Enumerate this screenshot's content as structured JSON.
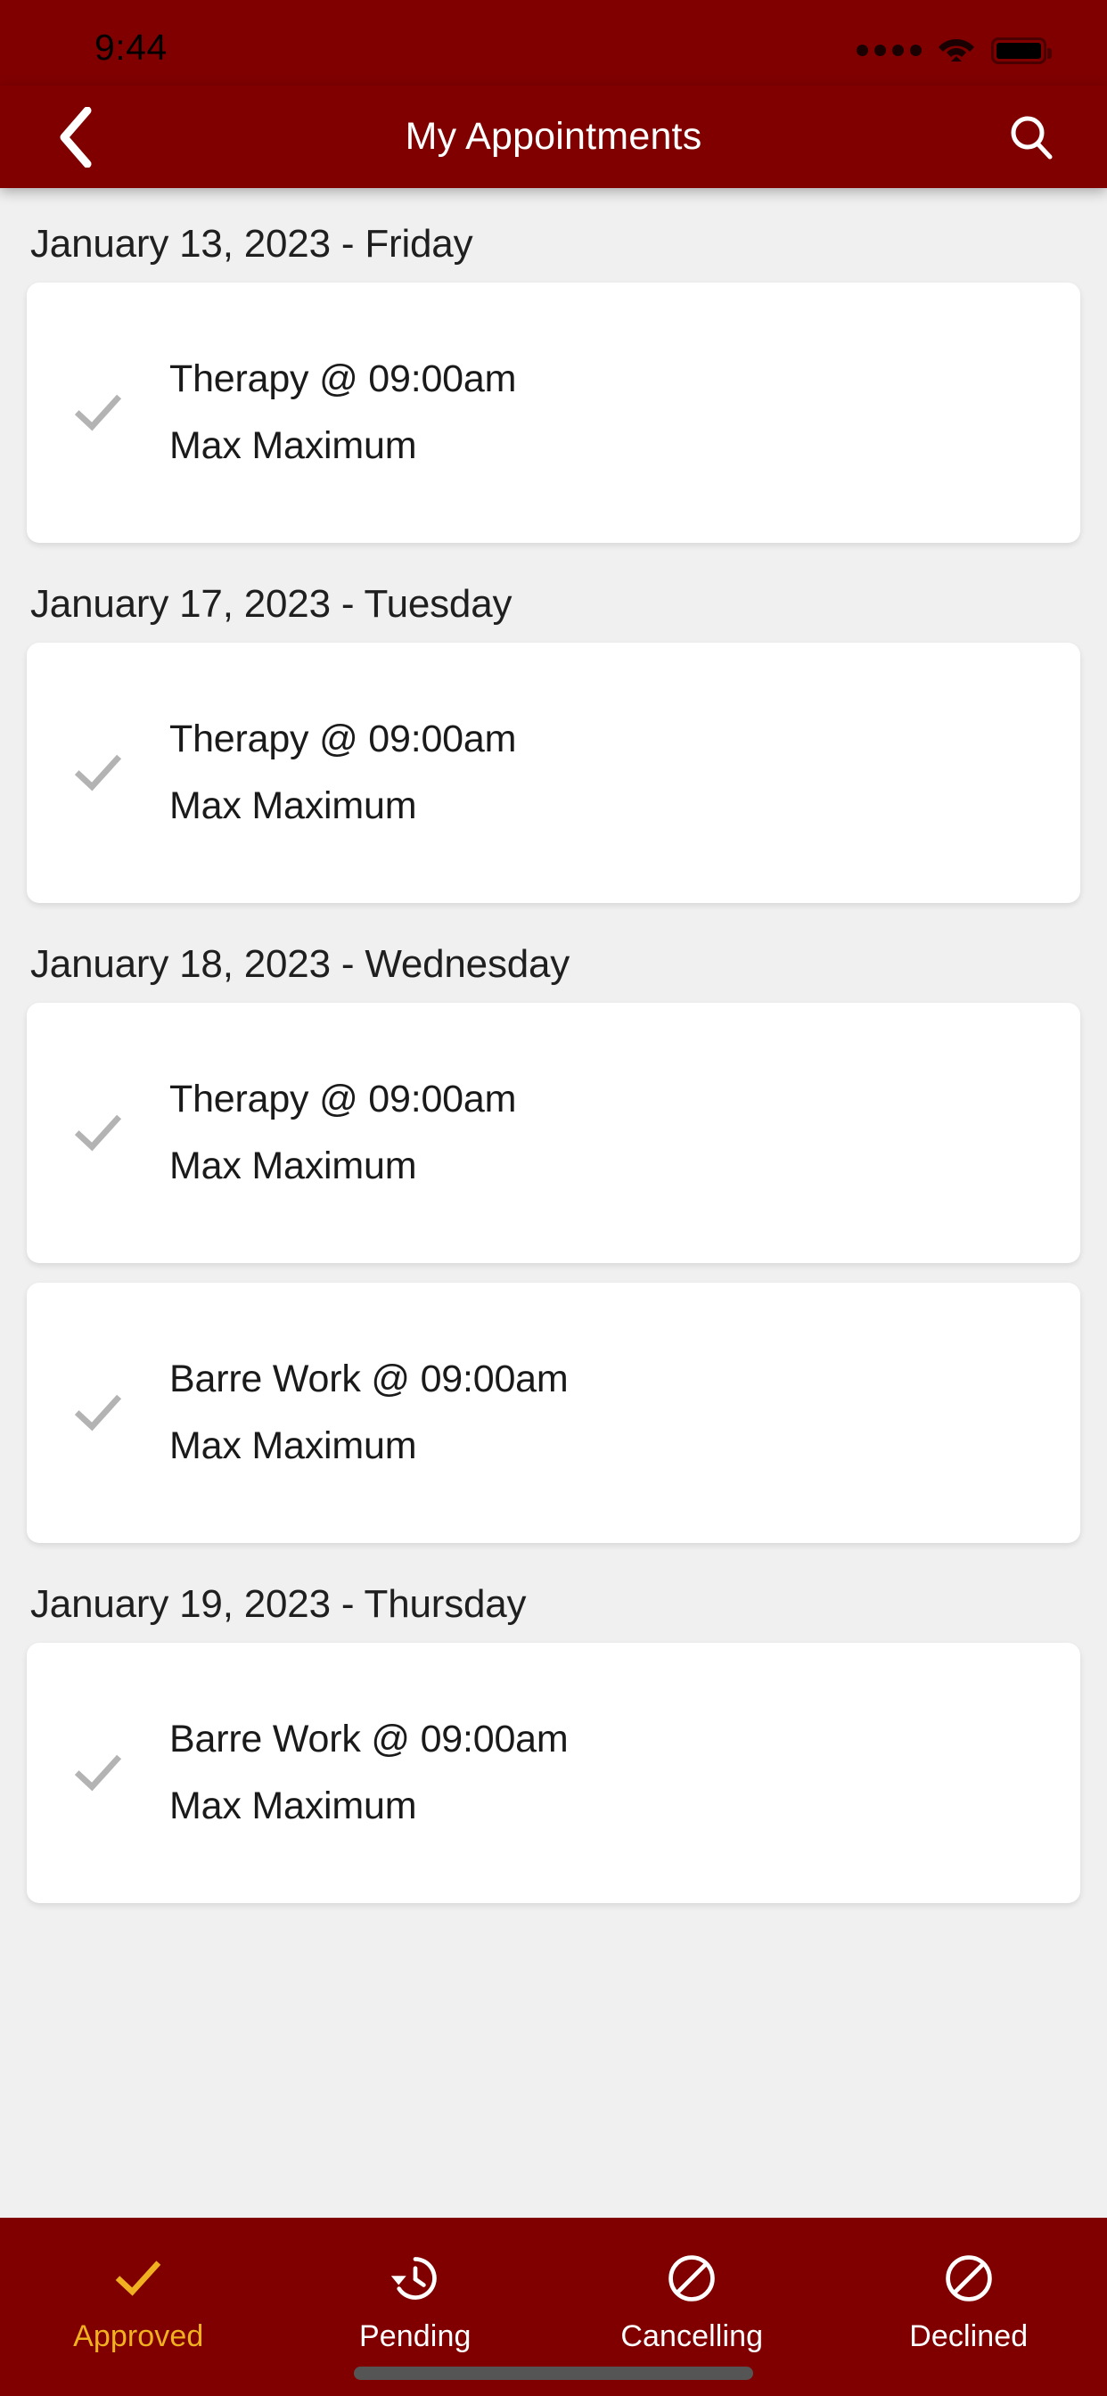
{
  "theme": {
    "brand_maroon": "#800000",
    "accent_gold": "#F0B020",
    "page_bg": "#f0f0f0",
    "card_bg": "#ffffff",
    "check_gray": "#b3b3b3"
  },
  "status_bar": {
    "time": "9:44",
    "signal_icon": "signal-dots-icon",
    "wifi_icon": "wifi-icon",
    "battery_icon": "battery-full-icon"
  },
  "header": {
    "title": "My Appointments",
    "back_icon": "chevron-left-icon",
    "search_icon": "search-icon"
  },
  "appointments": {
    "groups": [
      {
        "date": "January 13, 2023 - Friday",
        "items": [
          {
            "status_icon": "check-icon",
            "title": "Therapy @ 09:00am",
            "person": "Max Maximum"
          }
        ]
      },
      {
        "date": "January 17, 2023 - Tuesday",
        "items": [
          {
            "status_icon": "check-icon",
            "title": "Therapy @ 09:00am",
            "person": "Max Maximum"
          }
        ]
      },
      {
        "date": "January 18, 2023 - Wednesday",
        "items": [
          {
            "status_icon": "check-icon",
            "title": "Therapy @ 09:00am",
            "person": "Max Maximum"
          },
          {
            "status_icon": "check-icon",
            "title": "Barre Work @ 09:00am",
            "person": "Max Maximum"
          }
        ]
      },
      {
        "date": "January 19, 2023 - Thursday",
        "items": [
          {
            "status_icon": "check-icon",
            "title": "Barre Work @ 09:00am",
            "person": "Max Maximum"
          }
        ]
      }
    ]
  },
  "tabbar": {
    "active_index": 0,
    "tabs": [
      {
        "label": "Approved",
        "icon": "check-icon"
      },
      {
        "label": "Pending",
        "icon": "history-clock-icon"
      },
      {
        "label": "Cancelling",
        "icon": "circle-slash-icon"
      },
      {
        "label": "Declined",
        "icon": "circle-slash-icon"
      }
    ]
  }
}
